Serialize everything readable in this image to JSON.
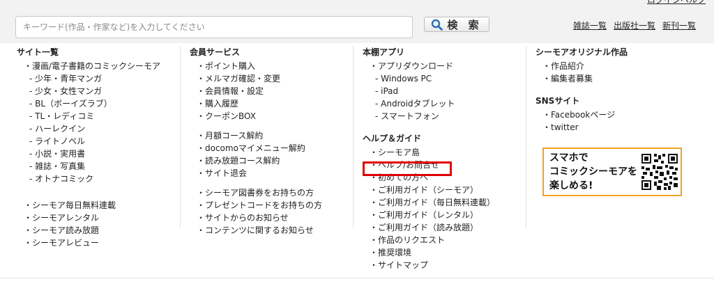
{
  "header": {
    "top_cut_link": "ログインヘルプ",
    "search_placeholder": "キーワード(作品・作家など)を入力してください",
    "search_button": "検 索",
    "links": [
      "雑誌一覧",
      "出版社一覧",
      "新刊一覧"
    ]
  },
  "columns": [
    {
      "heading": "サイト一覧",
      "groups": [
        [
          {
            "text": "・漫画/電子書籍のコミックシーモア",
            "level": 1
          },
          {
            "text": "- 少年・青年マンガ",
            "level": 2
          },
          {
            "text": "- 少女・女性マンガ",
            "level": 2
          },
          {
            "text": "- BL（ボーイズラブ）",
            "level": 2
          },
          {
            "text": "- TL・レディコミ",
            "level": 2
          },
          {
            "text": "- ハーレクイン",
            "level": 2
          },
          {
            "text": "- ライトノベル",
            "level": 2
          },
          {
            "text": "- 小説・実用書",
            "level": 2
          },
          {
            "text": "- 雑誌・写真集",
            "level": 2
          },
          {
            "text": "- オトナコミック",
            "level": 2
          }
        ],
        [
          {
            "text": "・シーモア毎日無料連載",
            "level": 1
          },
          {
            "text": "・シーモアレンタル",
            "level": 1
          },
          {
            "text": "・シーモア読み放題",
            "level": 1
          },
          {
            "text": "・シーモアレビュー",
            "level": 1
          }
        ]
      ]
    },
    {
      "heading": "会員サービス",
      "groups": [
        [
          {
            "text": "・ポイント購入",
            "level": 1
          },
          {
            "text": "・メルマガ確認・変更",
            "level": 1
          },
          {
            "text": "・会員情報・設定",
            "level": 1
          },
          {
            "text": "・購入履歴",
            "level": 1
          },
          {
            "text": "・クーポンBOX",
            "level": 1
          }
        ],
        [
          {
            "text": "・月額コース解約",
            "level": 1
          },
          {
            "text": "・docomoマイメニュー解約",
            "level": 1
          },
          {
            "text": "・読み放題コース解約",
            "level": 1
          },
          {
            "text": "・サイト退会",
            "level": 1
          }
        ],
        [
          {
            "text": "・シーモア図書券をお持ちの方",
            "level": 1
          },
          {
            "text": "・プレゼントコードをお持ちの方",
            "level": 1
          },
          {
            "text": "・サイトからのお知らせ",
            "level": 1
          },
          {
            "text": "・コンテンツに関するお知らせ",
            "level": 1
          }
        ]
      ]
    },
    {
      "heading": "本棚アプリ",
      "groups": [
        [
          {
            "text": "・アプリダウンロード",
            "level": 1
          },
          {
            "text": "- Windows PC",
            "level": 2
          },
          {
            "text": "- iPad",
            "level": 2
          },
          {
            "text": "- Androidタブレット",
            "level": 2
          },
          {
            "text": "- スマートフォン",
            "level": 2
          }
        ]
      ],
      "heading2": "ヘルプ＆ガイド",
      "groups2": [
        [
          {
            "text": "・シーモア島",
            "level": 1
          },
          {
            "text": "・ヘルプ/お問合せ",
            "level": 1
          },
          {
            "text": "・初めての方へ",
            "level": 1
          },
          {
            "text": "・ご利用ガイド（シーモア）",
            "level": 1
          },
          {
            "text": "・ご利用ガイド（毎日無料連載）",
            "level": 1
          },
          {
            "text": "・ご利用ガイド（レンタル）",
            "level": 1
          },
          {
            "text": "・ご利用ガイド（読み放題）",
            "level": 1
          },
          {
            "text": "・作品のリクエスト",
            "level": 1
          },
          {
            "text": "・推奨環境",
            "level": 1
          },
          {
            "text": "・サイトマップ",
            "level": 1
          }
        ]
      ]
    },
    {
      "heading": "シーモアオリジナル作品",
      "groups": [
        [
          {
            "text": "・作品紹介",
            "level": 1
          },
          {
            "text": "・編集者募集",
            "level": 1
          }
        ]
      ],
      "heading2": "SNSサイト",
      "groups2": [
        [
          {
            "text": "・Facebookページ",
            "level": 1
          },
          {
            "text": "・twitter",
            "level": 1
          }
        ]
      ]
    }
  ],
  "promo": {
    "lines": [
      "スマホで",
      "コミックシーモアを",
      "楽しめる!"
    ],
    "icon": "qr-code-icon",
    "border_color": "#f5a023"
  },
  "highlight_color": "#e00000"
}
